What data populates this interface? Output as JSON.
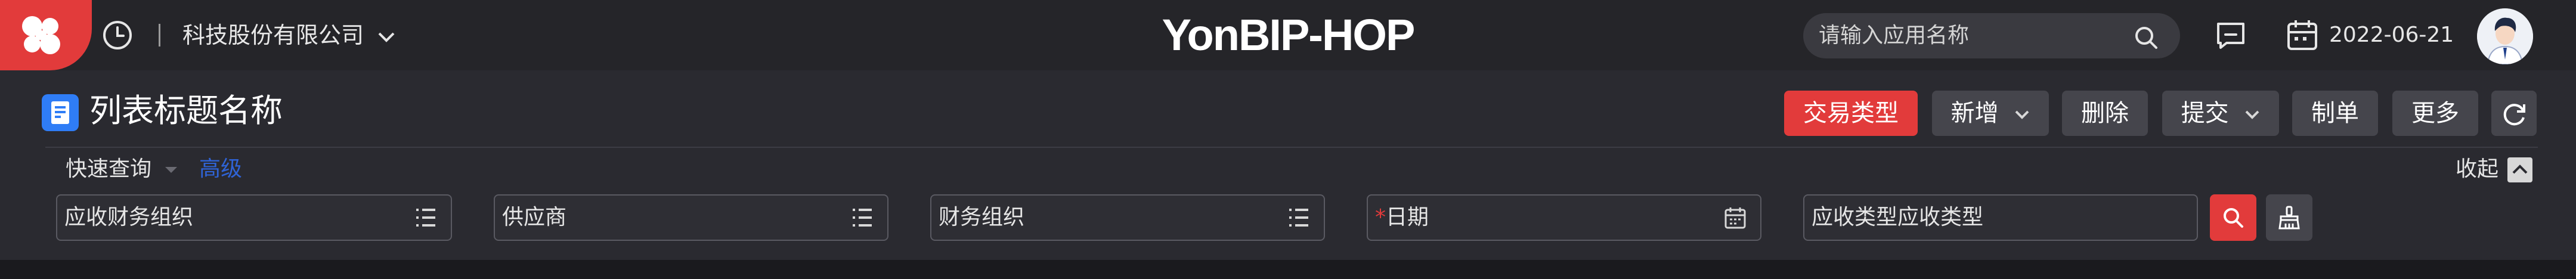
{
  "topbar": {
    "org_name": "科技股份有限公司",
    "brand": "YonBIP-HOP",
    "search_placeholder": "请输入应用名称",
    "date": "2022-06-21"
  },
  "page": {
    "title": "列表标题名称"
  },
  "toolbar": {
    "trade_type": "交易类型",
    "add": "新增",
    "delete": "删除",
    "submit": "提交",
    "make": "制单",
    "more": "更多"
  },
  "query": {
    "quick": "快速查询",
    "advanced": "高级",
    "collapse": "收起",
    "fields": [
      {
        "label": "应收财务组织"
      },
      {
        "label": "供应商"
      },
      {
        "label": "财务组织"
      },
      {
        "label": "日期",
        "required": "*"
      },
      {
        "label": "应收类型应收类型"
      }
    ]
  },
  "colors": {
    "accent": "#e23b3b",
    "link": "#2f63d6",
    "title_icon": "#2f7df6"
  }
}
